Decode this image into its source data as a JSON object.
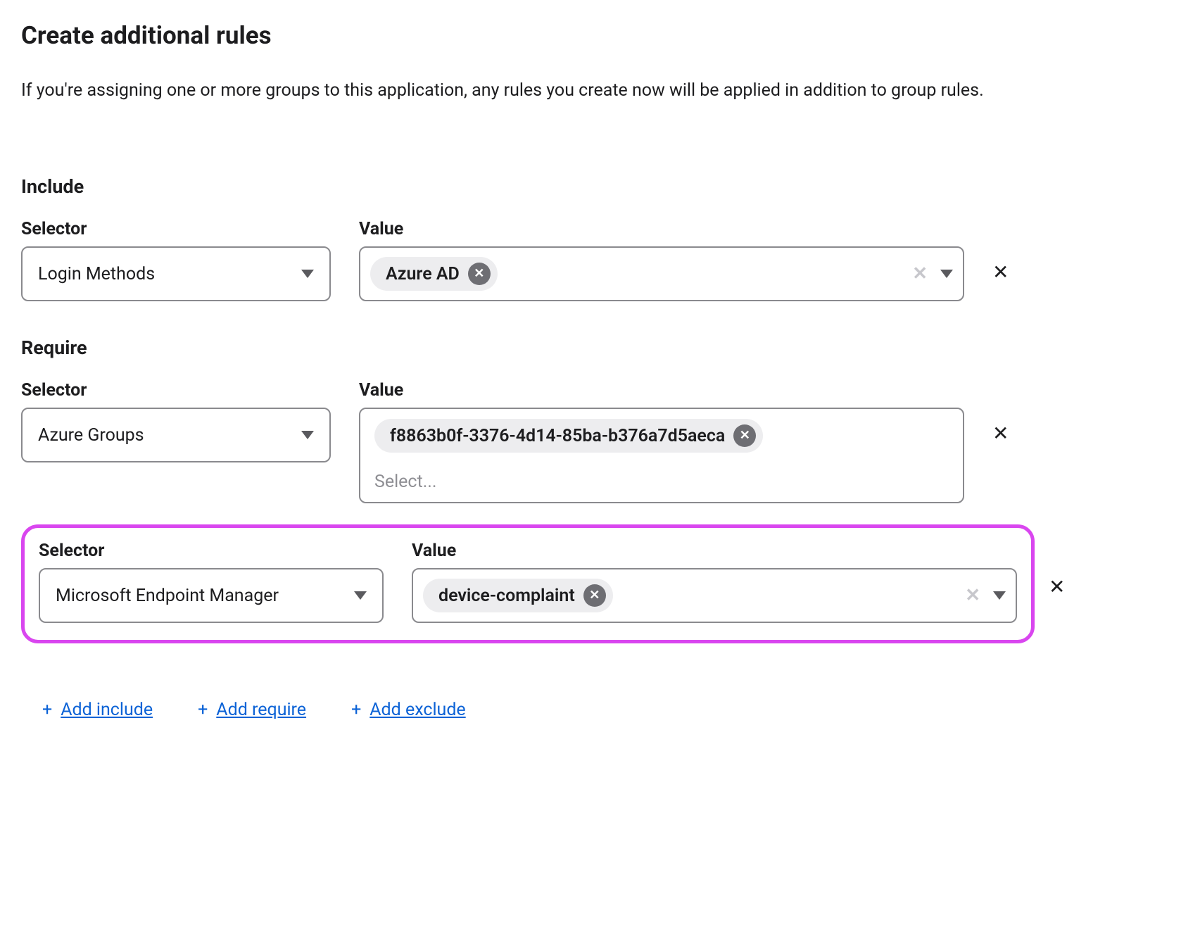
{
  "page": {
    "title": "Create additional rules",
    "description": "If you're assigning one or more groups to this application, any rules you create now will be applied in addition to group rules."
  },
  "labels": {
    "selector": "Selector",
    "value": "Value",
    "select_placeholder": "Select..."
  },
  "sections": {
    "include": {
      "heading": "Include",
      "rules": [
        {
          "selector": "Login Methods",
          "chips": [
            "Azure AD"
          ],
          "has_dropdown_caret": true,
          "has_clear": true
        }
      ]
    },
    "require": {
      "heading": "Require",
      "rules": [
        {
          "selector": "Azure Groups",
          "chips": [
            "f8863b0f-3376-4d14-85ba-b376a7d5aeca"
          ],
          "show_placeholder": true
        },
        {
          "selector": "Microsoft Endpoint Manager",
          "chips": [
            "device-complaint"
          ],
          "has_dropdown_caret": true,
          "has_clear": true,
          "highlighted": true
        }
      ]
    }
  },
  "actions": {
    "add_include": "Add include",
    "add_require": "Add require",
    "add_exclude": "Add exclude"
  }
}
